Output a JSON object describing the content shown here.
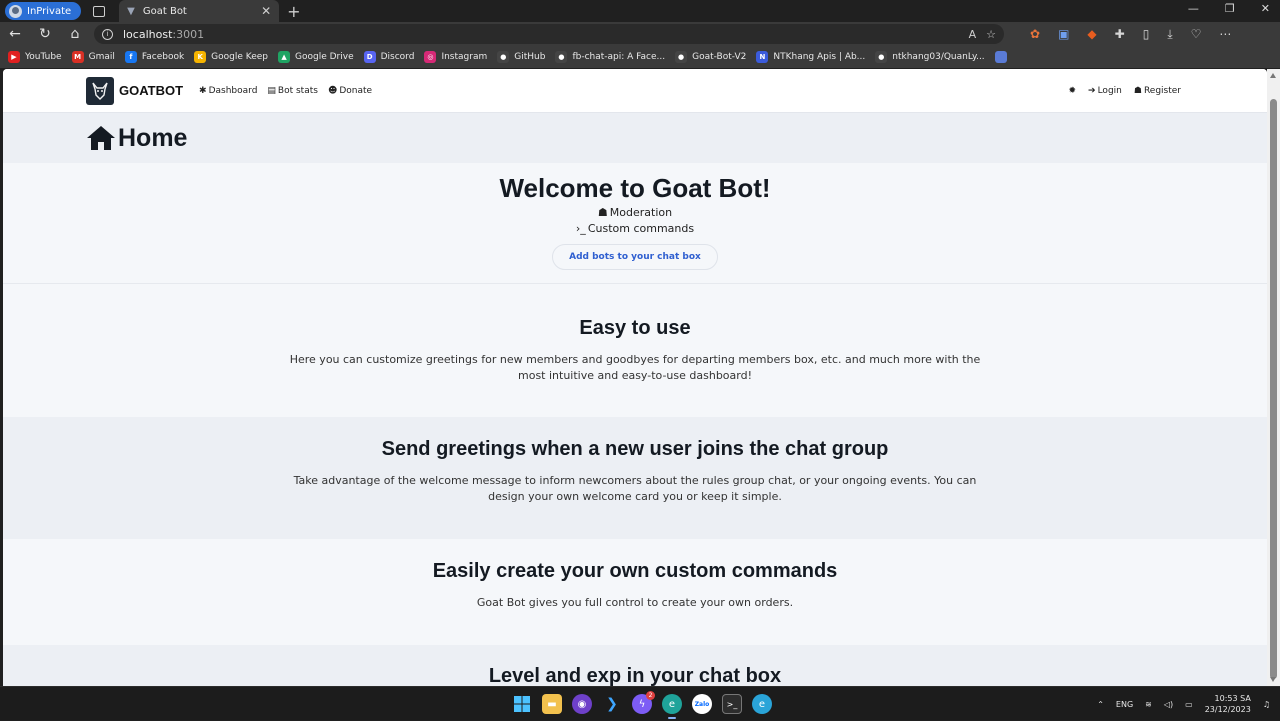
{
  "browser": {
    "inprivate_label": "InPrivate",
    "tab_title": "Goat Bot",
    "url_host": "localhost",
    "url_port": ":3001"
  },
  "bookmarks": [
    {
      "label": "YouTube",
      "icon": "youtube-icon",
      "color": "#e02020",
      "glyph": "▶"
    },
    {
      "label": "Gmail",
      "icon": "gmail-icon",
      "color": "#d93025",
      "glyph": "M"
    },
    {
      "label": "Facebook",
      "icon": "facebook-icon",
      "color": "#1877f2",
      "glyph": "f"
    },
    {
      "label": "Google Keep",
      "icon": "keep-icon",
      "color": "#f6b400",
      "glyph": "K"
    },
    {
      "label": "Google Drive",
      "icon": "drive-icon",
      "color": "#1fa463",
      "glyph": "▲"
    },
    {
      "label": "Discord",
      "icon": "discord-icon",
      "color": "#5865f2",
      "glyph": "D"
    },
    {
      "label": "Instagram",
      "icon": "instagram-icon",
      "color": "#d62976",
      "glyph": "◎"
    },
    {
      "label": "GitHub",
      "icon": "github-icon",
      "color": "#444444",
      "glyph": "●"
    },
    {
      "label": "fb-chat-api: A Face...",
      "icon": "github-icon",
      "color": "#444444",
      "glyph": "●"
    },
    {
      "label": "Goat-Bot-V2",
      "icon": "github-icon",
      "color": "#444444",
      "glyph": "●"
    },
    {
      "label": "NTKhang Apis | Ab...",
      "icon": "ntk-icon",
      "color": "#3b5bdb",
      "glyph": "N"
    },
    {
      "label": "ntkhang03/QuanLy...",
      "icon": "github-icon",
      "color": "#444444",
      "glyph": "●"
    }
  ],
  "nav": {
    "brand": "GOATBOT",
    "dashboard": "Dashboard",
    "bot_stats": "Bot stats",
    "donate": "Donate",
    "login": "Login",
    "register": "Register"
  },
  "page": {
    "home_title": "Home",
    "hero_title": "Welcome to Goat Bot!",
    "feature_moderation": "Moderation",
    "feature_commands": "Custom commands",
    "cta": "Add bots to your chat box"
  },
  "sections": [
    {
      "title": "Easy to use",
      "text": "Here you can customize greetings for new members and goodbyes for departing members box, etc. and much more with the most intuitive and easy-to-use dashboard!"
    },
    {
      "title": "Send greetings when a new user joins the chat group",
      "text": "Take advantage of the welcome message to inform newcomers about the rules group chat, or your ongoing events. You can design your own welcome card you or keep it simple."
    },
    {
      "title": "Easily create your own custom commands",
      "text": "Goat Bot gives you full control to create your own orders."
    },
    {
      "title": "Level and exp in your chat box"
    }
  ],
  "taskbar": {
    "messenger_badge": "2",
    "lang": "ENG",
    "time": "10:53 SA",
    "date": "23/12/2023"
  }
}
